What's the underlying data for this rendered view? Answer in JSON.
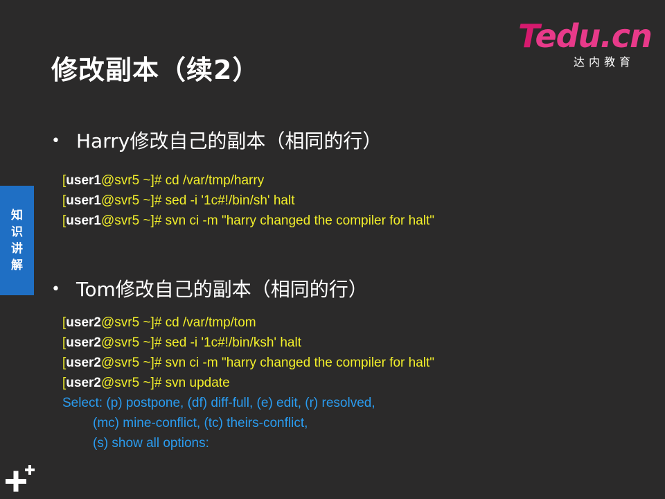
{
  "title": "修改副本（续2）",
  "logo": {
    "text_t": "T",
    "text_rest": "edu.cn",
    "subtitle": "达内教育"
  },
  "side_tab": {
    "chars": [
      "知",
      "识",
      "讲",
      "解"
    ]
  },
  "sections": [
    {
      "heading": "Harry修改自己的副本（相同的行）",
      "lines": [
        {
          "bracket": "[",
          "user": "user1",
          "host": "@svr5 ~]# ",
          "cmd": "cd /var/tmp/harry"
        },
        {
          "bracket": "[",
          "user": "user1",
          "host": "@svr5 ~]# ",
          "cmd": "sed -i '1c#!/bin/sh' halt"
        },
        {
          "bracket": "[",
          "user": "user1",
          "host": "@svr5 ~]# ",
          "cmd": "svn ci -m \"harry changed the compiler for halt\""
        }
      ]
    },
    {
      "heading": "Tom修改自己的副本（相同的行）",
      "lines": [
        {
          "bracket": "[",
          "user": "user2",
          "host": "@svr5 ~]# ",
          "cmd": "cd /var/tmp/tom"
        },
        {
          "bracket": "[",
          "user": "user2",
          "host": "@svr5 ~]# ",
          "cmd": "sed -i '1c#!/bin/ksh' halt"
        },
        {
          "bracket": "[",
          "user": "user2",
          "host": "@svr5 ~]# ",
          "cmd": "svn ci -m \"harry changed the compiler for halt\""
        },
        {
          "bracket": "[",
          "user": "user2",
          "host": "@svr5 ~]# ",
          "cmd": "svn update"
        }
      ],
      "output": [
        "Select: (p) postpone, (df) diff-full, (e) edit, (r) resolved,",
        "(mc) mine-conflict, (tc) theirs-conflict,",
        "(s) show all options:"
      ]
    }
  ],
  "colors": {
    "background": "#2b2a2a",
    "prompt": "#f2ef2a",
    "output": "#2a9cf0",
    "tab": "#1f6fc4",
    "logo": "#e83a8a"
  },
  "icons": {
    "corner": "plus-icon"
  }
}
